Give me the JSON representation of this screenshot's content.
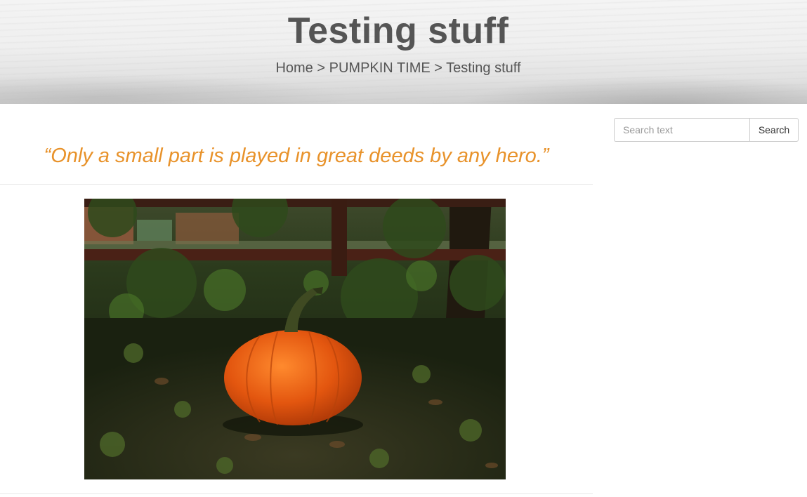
{
  "header": {
    "title": "Testing stuff",
    "breadcrumb": {
      "home": "Home",
      "sep1": ">",
      "category": "PUMPKIN TIME",
      "sep2": ">",
      "current": "Testing stuff"
    }
  },
  "sidebar": {
    "search": {
      "placeholder": "Search text",
      "value": "",
      "button_label": "Search"
    }
  },
  "content": {
    "quote": "“Only a small part is played in great deeds by any hero.”",
    "image": {
      "subject": "orange pumpkin on leafy ground beside a wooden fence"
    }
  },
  "colors": {
    "accent": "#e8922a",
    "text": "#555555",
    "pumpkin": "#e05a10"
  }
}
